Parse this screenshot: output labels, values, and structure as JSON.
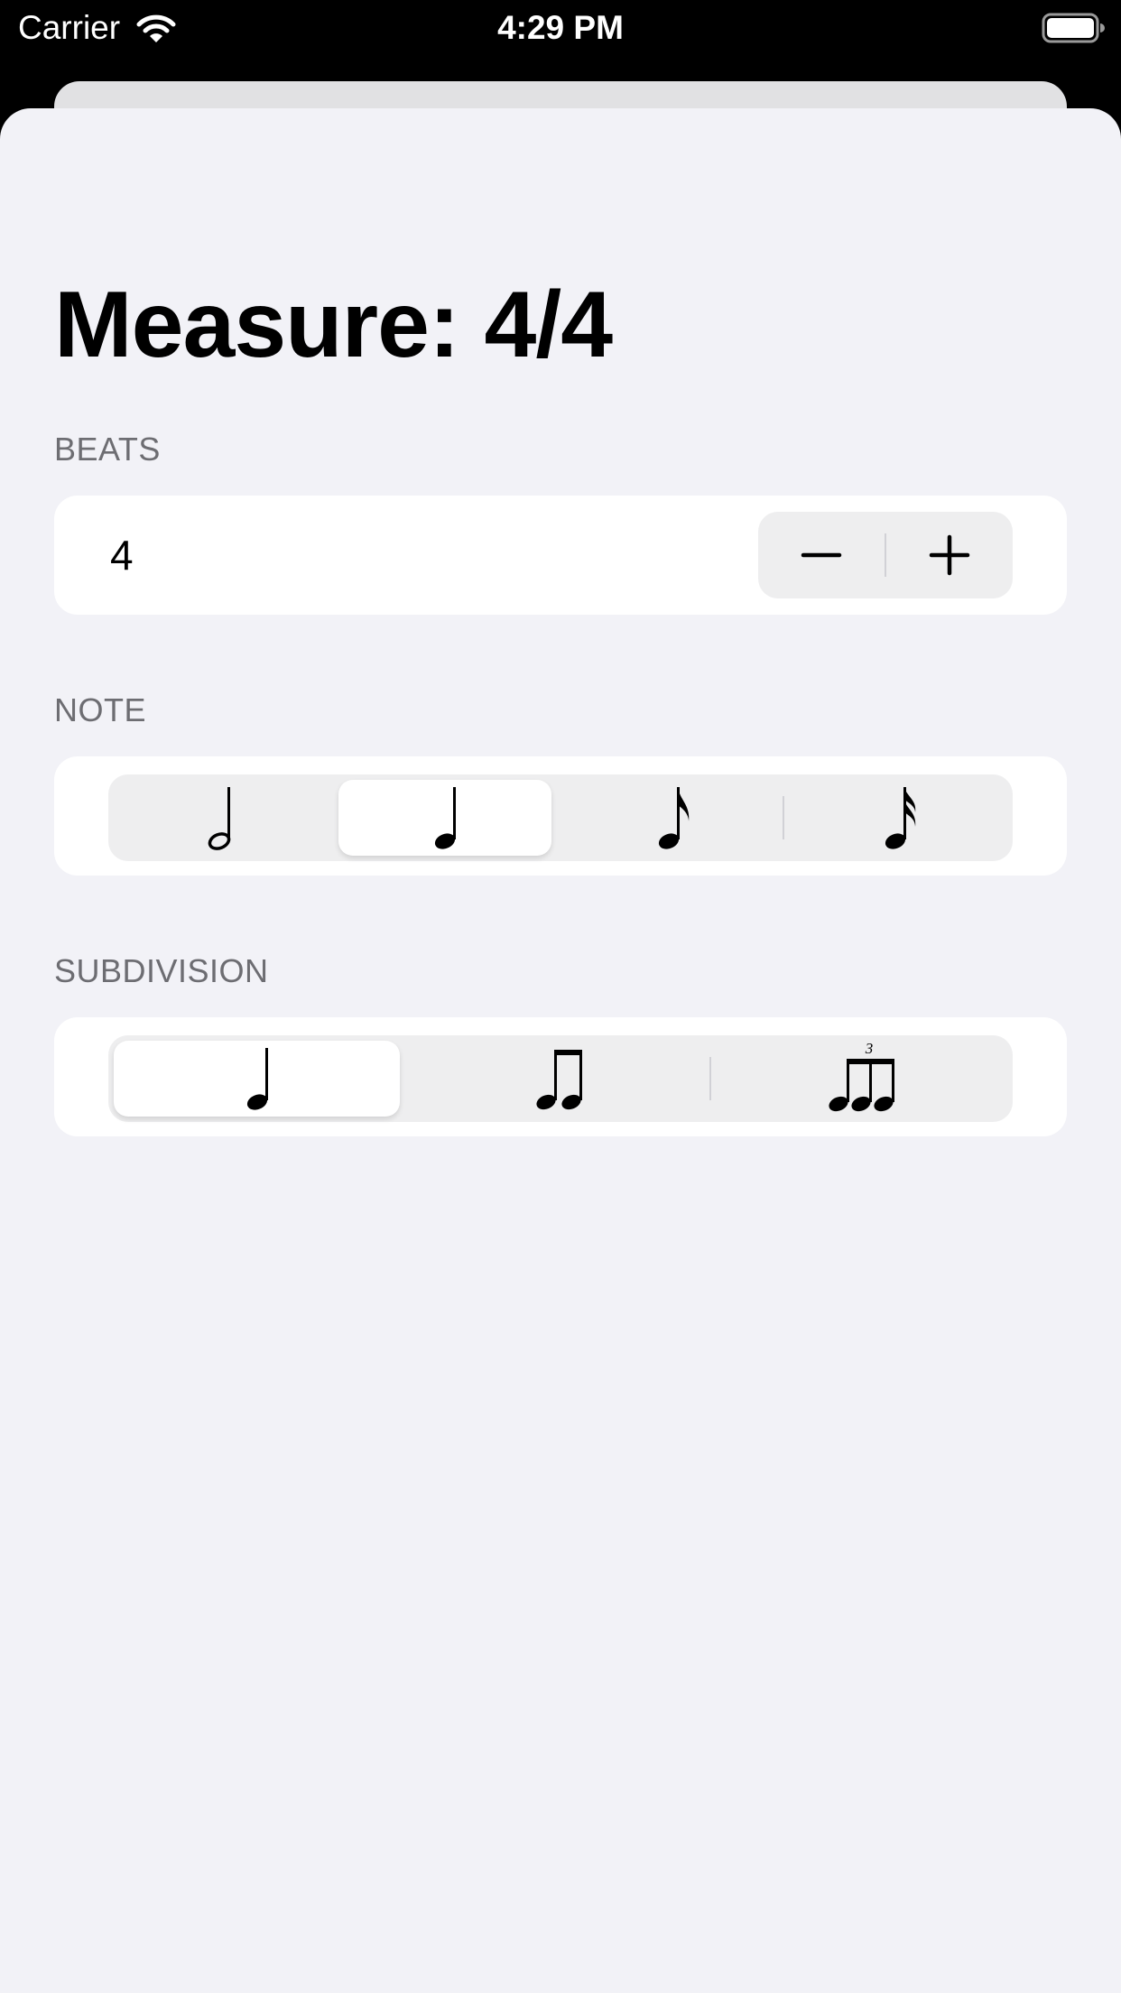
{
  "status_bar": {
    "carrier": "Carrier",
    "time": "4:29 PM",
    "wifi_icon": "wifi-icon",
    "battery_icon": "battery-full-icon"
  },
  "title": "Measure: 4/4",
  "beats": {
    "header": "BEATS",
    "value": "4",
    "decrement_icon": "minus-icon",
    "increment_icon": "plus-icon"
  },
  "note": {
    "header": "NOTE",
    "options": [
      "half-note-icon",
      "quarter-note-icon",
      "eighth-note-icon",
      "sixteenth-note-icon"
    ],
    "selected_index": 1
  },
  "subdivision": {
    "header": "SUBDIVISION",
    "options": [
      "quarter-note-icon",
      "two-beamed-eighth-notes-icon",
      "triplet-eighth-notes-icon"
    ],
    "triplet_label": "3",
    "selected_index": 0
  },
  "colors": {
    "background": "#f2f2f7",
    "card": "#ffffff",
    "segment_track": "#eeeeef",
    "section_header": "#6d6d72"
  }
}
